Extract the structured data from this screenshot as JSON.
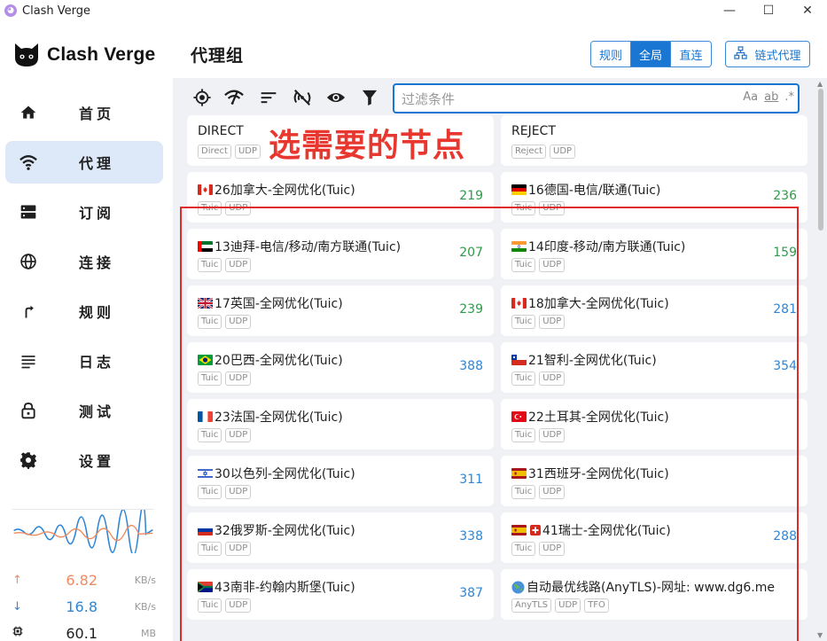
{
  "window": {
    "title": "Clash Verge",
    "minimize": "—",
    "maximize": "☐",
    "close": "✕"
  },
  "sidebar": {
    "logo_text": "Clash Verge",
    "items": [
      {
        "label": "首页",
        "icon": "home-icon"
      },
      {
        "label": "代理",
        "icon": "wifi-icon",
        "active": true
      },
      {
        "label": "订阅",
        "icon": "dns-icon"
      },
      {
        "label": "连接",
        "icon": "globe-icon"
      },
      {
        "label": "规则",
        "icon": "fork-arrow-icon"
      },
      {
        "label": "日志",
        "icon": "list-icon"
      },
      {
        "label": "测试",
        "icon": "lock-icon"
      },
      {
        "label": "设置",
        "icon": "gear-icon"
      }
    ],
    "traffic": {
      "upload": {
        "value": "6.82",
        "unit": "KB/s",
        "arrow": "↑",
        "color": "#f08a5d"
      },
      "download": {
        "value": "16.8",
        "unit": "KB/s",
        "arrow": "↓",
        "color": "#2f86d4"
      },
      "memory": {
        "value": "60.1",
        "unit": "MB"
      }
    }
  },
  "header": {
    "title": "代理组",
    "modes": [
      {
        "label": "规则",
        "active": false
      },
      {
        "label": "全局",
        "active": true
      },
      {
        "label": "直连",
        "active": false
      }
    ],
    "chain_button": "链式代理"
  },
  "toolbar": {
    "filter_placeholder": "过滤条件",
    "opt_case": "Aa",
    "opt_word": "ab",
    "opt_regex": ".*"
  },
  "annotation": "选需要的节点",
  "proxies": [
    {
      "name": "DIRECT",
      "tags": [
        "Direct",
        "UDP"
      ],
      "delay": "",
      "flag": "",
      "color": ""
    },
    {
      "name": "REJECT",
      "tags": [
        "Reject",
        "UDP"
      ],
      "delay": "",
      "flag": "",
      "color": ""
    },
    {
      "name": "26加拿大-全网优化(Tuic)",
      "tags": [
        "Tuic",
        "UDP"
      ],
      "delay": "219",
      "flag": "ca",
      "color": "green"
    },
    {
      "name": "16德国-电信/联通(Tuic)",
      "tags": [
        "Tuic",
        "UDP"
      ],
      "delay": "236",
      "flag": "de",
      "color": "green"
    },
    {
      "name": "13迪拜-电信/移动/南方联通(Tuic)",
      "tags": [
        "Tuic",
        "UDP"
      ],
      "delay": "207",
      "flag": "ae",
      "color": "green"
    },
    {
      "name": "14印度-移动/南方联通(Tuic)",
      "tags": [
        "Tuic",
        "UDP"
      ],
      "delay": "159",
      "flag": "in",
      "color": "green"
    },
    {
      "name": "17英国-全网优化(Tuic)",
      "tags": [
        "Tuic",
        "UDP"
      ],
      "delay": "239",
      "flag": "gb",
      "color": "green"
    },
    {
      "name": "18加拿大-全网优化(Tuic)",
      "tags": [
        "Tuic",
        "UDP"
      ],
      "delay": "281",
      "flag": "ca",
      "color": "blue"
    },
    {
      "name": "20巴西-全网优化(Tuic)",
      "tags": [
        "Tuic",
        "UDP"
      ],
      "delay": "388",
      "flag": "br",
      "color": "blue"
    },
    {
      "name": "21智利-全网优化(Tuic)",
      "tags": [
        "Tuic",
        "UDP"
      ],
      "delay": "354",
      "flag": "cl",
      "color": "blue"
    },
    {
      "name": "23法国-全网优化(Tuic)",
      "tags": [
        "Tuic",
        "UDP"
      ],
      "delay": "",
      "flag": "fr",
      "color": ""
    },
    {
      "name": "22土耳其-全网优化(Tuic)",
      "tags": [
        "Tuic",
        "UDP"
      ],
      "delay": "",
      "flag": "tr",
      "color": ""
    },
    {
      "name": "30以色列-全网优化(Tuic)",
      "tags": [
        "Tuic",
        "UDP"
      ],
      "delay": "311",
      "flag": "il",
      "color": "blue"
    },
    {
      "name": "31西班牙-全网优化(Tuic)",
      "tags": [
        "Tuic",
        "UDP"
      ],
      "delay": "",
      "flag": "es",
      "color": ""
    },
    {
      "name": "32俄罗斯-全网优化(Tuic)",
      "tags": [
        "Tuic",
        "UDP"
      ],
      "delay": "338",
      "flag": "ru",
      "color": "blue"
    },
    {
      "name": "41瑞士-全网优化(Tuic)",
      "tags": [
        "Tuic",
        "UDP"
      ],
      "delay": "288",
      "flag": "es-ch",
      "color": "blue"
    },
    {
      "name": "43南非-约翰内斯堡(Tuic)",
      "tags": [
        "Tuic",
        "UDP"
      ],
      "delay": "387",
      "flag": "za",
      "color": "blue"
    },
    {
      "name": "自动最优线路(AnyTLS)-网址: www.dg6.me",
      "tags": [
        "AnyTLS",
        "UDP",
        "TFO"
      ],
      "delay": "",
      "flag": "globe",
      "color": ""
    }
  ]
}
